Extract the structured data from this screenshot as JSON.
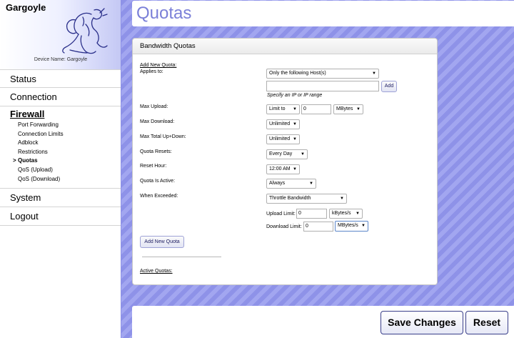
{
  "sidebar": {
    "brand": "Gargoyle",
    "device_name": "Device Name: Gargoyle",
    "status": "Status",
    "connection": "Connection",
    "firewall": "Firewall",
    "firewall_items": [
      "Port Forwarding",
      "Connection Limits",
      "Adblock",
      "Restrictions",
      "Quotas",
      "QoS (Upload)",
      "QoS (Download)"
    ],
    "active_marker": ">",
    "system": "System",
    "logout": "Logout"
  },
  "header": {
    "title": "Quotas"
  },
  "panel": {
    "title": "Bandwidth Quotas",
    "add_new_quota": "Add New Quota:",
    "applies_to_label": "Applies to:",
    "applies_to_value": "Only the following Host(s)",
    "host_input_value": "",
    "add_button": "Add",
    "hint": "Specify an IP or IP range",
    "max_upload_label": "Max Upload:",
    "max_upload_mode": "Limit to",
    "max_upload_amount": "0",
    "max_upload_unit": "MBytes",
    "max_download_label": "Max Download:",
    "max_download_mode": "Unlimited",
    "max_total_label": "Max Total Up+Down:",
    "max_total_mode": "Unlimited",
    "resets_label": "Quota Resets:",
    "resets_value": "Every Day",
    "reset_hour_label": "Reset Hour:",
    "reset_hour_value": "12:00 AM",
    "active_label": "Quota Is Active:",
    "active_value": "Always",
    "exceeded_label": "When Exceeded:",
    "exceeded_value": "Throttle Bandwidth",
    "upload_limit_label": "Upload Limit:",
    "upload_limit_value": "0",
    "upload_limit_unit": "kBytes/s",
    "download_limit_label": "Download Limit:",
    "download_limit_value": "0",
    "download_limit_unit": "MBytes/s",
    "add_new_quota_button": "Add New Quota",
    "active_quotas": "Active Quotas:"
  },
  "footer": {
    "save": "Save Changes",
    "reset": "Reset"
  },
  "colors": {
    "background": "#8e92e8",
    "title": "#7b80d8",
    "button_border": "#3a3f8a"
  }
}
